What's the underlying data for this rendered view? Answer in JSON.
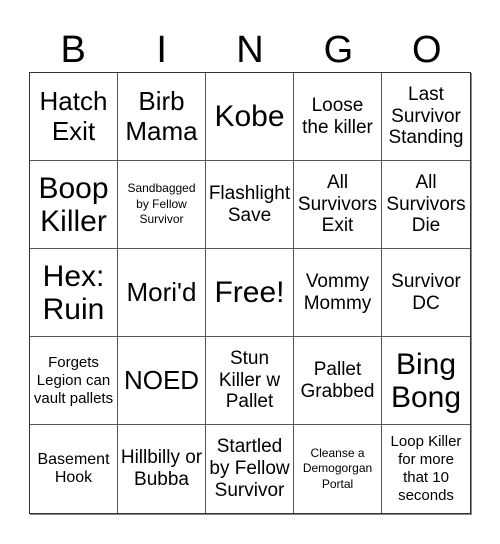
{
  "header": {
    "letters": [
      "B",
      "I",
      "N",
      "G",
      "O"
    ]
  },
  "cells": [
    {
      "text": "Hatch Exit"
    },
    {
      "text": "Birb Mama"
    },
    {
      "text": "Kobe"
    },
    {
      "text": "Loose the killer"
    },
    {
      "text": "Last Survivor Standing"
    },
    {
      "text": "Boop Killer"
    },
    {
      "text": "Sandbagged by Fellow Survivor"
    },
    {
      "text": "Flashlight Save"
    },
    {
      "text": "All Survivors Exit"
    },
    {
      "text": "All Survivors Die"
    },
    {
      "text": "Hex: Ruin"
    },
    {
      "text": "Mori'd"
    },
    {
      "text": "Free!"
    },
    {
      "text": "Vommy Mommy"
    },
    {
      "text": "Survivor DC"
    },
    {
      "text": "Forgets Legion can vault pallets"
    },
    {
      "text": "NOED"
    },
    {
      "text": "Stun Killer w Pallet"
    },
    {
      "text": "Pallet Grabbed"
    },
    {
      "text": "Bing Bong"
    },
    {
      "text": "Basement Hook"
    },
    {
      "text": "Hillbilly or Bubba"
    },
    {
      "text": "Startled by Fellow Survivor"
    },
    {
      "text": "Cleanse a Demogorgan Portal"
    },
    {
      "text": "Loop Killer for more that 10 seconds"
    }
  ]
}
